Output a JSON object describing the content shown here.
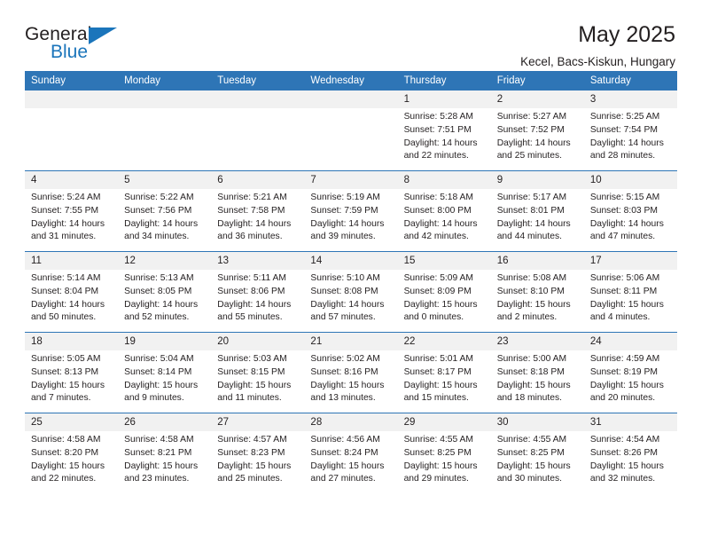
{
  "logo": {
    "word1": "General",
    "word2": "Blue",
    "accent_color": "#1b75bb"
  },
  "header": {
    "title": "May 2025",
    "location": "Kecel, Bacs-Kiskun, Hungary"
  },
  "theme": {
    "header_bg": "#2e75b6",
    "daynum_bg": "#f1f1f1",
    "text": "#231f20"
  },
  "weekday_headers": [
    "Sunday",
    "Monday",
    "Tuesday",
    "Wednesday",
    "Thursday",
    "Friday",
    "Saturday"
  ],
  "weeks": [
    [
      {
        "day": "",
        "blank": true
      },
      {
        "day": "",
        "blank": true
      },
      {
        "day": "",
        "blank": true
      },
      {
        "day": "",
        "blank": true
      },
      {
        "day": "1",
        "sunrise": "Sunrise: 5:28 AM",
        "sunset": "Sunset: 7:51 PM",
        "daylight": "Daylight: 14 hours and 22 minutes."
      },
      {
        "day": "2",
        "sunrise": "Sunrise: 5:27 AM",
        "sunset": "Sunset: 7:52 PM",
        "daylight": "Daylight: 14 hours and 25 minutes."
      },
      {
        "day": "3",
        "sunrise": "Sunrise: 5:25 AM",
        "sunset": "Sunset: 7:54 PM",
        "daylight": "Daylight: 14 hours and 28 minutes."
      }
    ],
    [
      {
        "day": "4",
        "sunrise": "Sunrise: 5:24 AM",
        "sunset": "Sunset: 7:55 PM",
        "daylight": "Daylight: 14 hours and 31 minutes."
      },
      {
        "day": "5",
        "sunrise": "Sunrise: 5:22 AM",
        "sunset": "Sunset: 7:56 PM",
        "daylight": "Daylight: 14 hours and 34 minutes."
      },
      {
        "day": "6",
        "sunrise": "Sunrise: 5:21 AM",
        "sunset": "Sunset: 7:58 PM",
        "daylight": "Daylight: 14 hours and 36 minutes."
      },
      {
        "day": "7",
        "sunrise": "Sunrise: 5:19 AM",
        "sunset": "Sunset: 7:59 PM",
        "daylight": "Daylight: 14 hours and 39 minutes."
      },
      {
        "day": "8",
        "sunrise": "Sunrise: 5:18 AM",
        "sunset": "Sunset: 8:00 PM",
        "daylight": "Daylight: 14 hours and 42 minutes."
      },
      {
        "day": "9",
        "sunrise": "Sunrise: 5:17 AM",
        "sunset": "Sunset: 8:01 PM",
        "daylight": "Daylight: 14 hours and 44 minutes."
      },
      {
        "day": "10",
        "sunrise": "Sunrise: 5:15 AM",
        "sunset": "Sunset: 8:03 PM",
        "daylight": "Daylight: 14 hours and 47 minutes."
      }
    ],
    [
      {
        "day": "11",
        "sunrise": "Sunrise: 5:14 AM",
        "sunset": "Sunset: 8:04 PM",
        "daylight": "Daylight: 14 hours and 50 minutes."
      },
      {
        "day": "12",
        "sunrise": "Sunrise: 5:13 AM",
        "sunset": "Sunset: 8:05 PM",
        "daylight": "Daylight: 14 hours and 52 minutes."
      },
      {
        "day": "13",
        "sunrise": "Sunrise: 5:11 AM",
        "sunset": "Sunset: 8:06 PM",
        "daylight": "Daylight: 14 hours and 55 minutes."
      },
      {
        "day": "14",
        "sunrise": "Sunrise: 5:10 AM",
        "sunset": "Sunset: 8:08 PM",
        "daylight": "Daylight: 14 hours and 57 minutes."
      },
      {
        "day": "15",
        "sunrise": "Sunrise: 5:09 AM",
        "sunset": "Sunset: 8:09 PM",
        "daylight": "Daylight: 15 hours and 0 minutes."
      },
      {
        "day": "16",
        "sunrise": "Sunrise: 5:08 AM",
        "sunset": "Sunset: 8:10 PM",
        "daylight": "Daylight: 15 hours and 2 minutes."
      },
      {
        "day": "17",
        "sunrise": "Sunrise: 5:06 AM",
        "sunset": "Sunset: 8:11 PM",
        "daylight": "Daylight: 15 hours and 4 minutes."
      }
    ],
    [
      {
        "day": "18",
        "sunrise": "Sunrise: 5:05 AM",
        "sunset": "Sunset: 8:13 PM",
        "daylight": "Daylight: 15 hours and 7 minutes."
      },
      {
        "day": "19",
        "sunrise": "Sunrise: 5:04 AM",
        "sunset": "Sunset: 8:14 PM",
        "daylight": "Daylight: 15 hours and 9 minutes."
      },
      {
        "day": "20",
        "sunrise": "Sunrise: 5:03 AM",
        "sunset": "Sunset: 8:15 PM",
        "daylight": "Daylight: 15 hours and 11 minutes."
      },
      {
        "day": "21",
        "sunrise": "Sunrise: 5:02 AM",
        "sunset": "Sunset: 8:16 PM",
        "daylight": "Daylight: 15 hours and 13 minutes."
      },
      {
        "day": "22",
        "sunrise": "Sunrise: 5:01 AM",
        "sunset": "Sunset: 8:17 PM",
        "daylight": "Daylight: 15 hours and 15 minutes."
      },
      {
        "day": "23",
        "sunrise": "Sunrise: 5:00 AM",
        "sunset": "Sunset: 8:18 PM",
        "daylight": "Daylight: 15 hours and 18 minutes."
      },
      {
        "day": "24",
        "sunrise": "Sunrise: 4:59 AM",
        "sunset": "Sunset: 8:19 PM",
        "daylight": "Daylight: 15 hours and 20 minutes."
      }
    ],
    [
      {
        "day": "25",
        "sunrise": "Sunrise: 4:58 AM",
        "sunset": "Sunset: 8:20 PM",
        "daylight": "Daylight: 15 hours and 22 minutes."
      },
      {
        "day": "26",
        "sunrise": "Sunrise: 4:58 AM",
        "sunset": "Sunset: 8:21 PM",
        "daylight": "Daylight: 15 hours and 23 minutes."
      },
      {
        "day": "27",
        "sunrise": "Sunrise: 4:57 AM",
        "sunset": "Sunset: 8:23 PM",
        "daylight": "Daylight: 15 hours and 25 minutes."
      },
      {
        "day": "28",
        "sunrise": "Sunrise: 4:56 AM",
        "sunset": "Sunset: 8:24 PM",
        "daylight": "Daylight: 15 hours and 27 minutes."
      },
      {
        "day": "29",
        "sunrise": "Sunrise: 4:55 AM",
        "sunset": "Sunset: 8:25 PM",
        "daylight": "Daylight: 15 hours and 29 minutes."
      },
      {
        "day": "30",
        "sunrise": "Sunrise: 4:55 AM",
        "sunset": "Sunset: 8:25 PM",
        "daylight": "Daylight: 15 hours and 30 minutes."
      },
      {
        "day": "31",
        "sunrise": "Sunrise: 4:54 AM",
        "sunset": "Sunset: 8:26 PM",
        "daylight": "Daylight: 15 hours and 32 minutes."
      }
    ]
  ]
}
